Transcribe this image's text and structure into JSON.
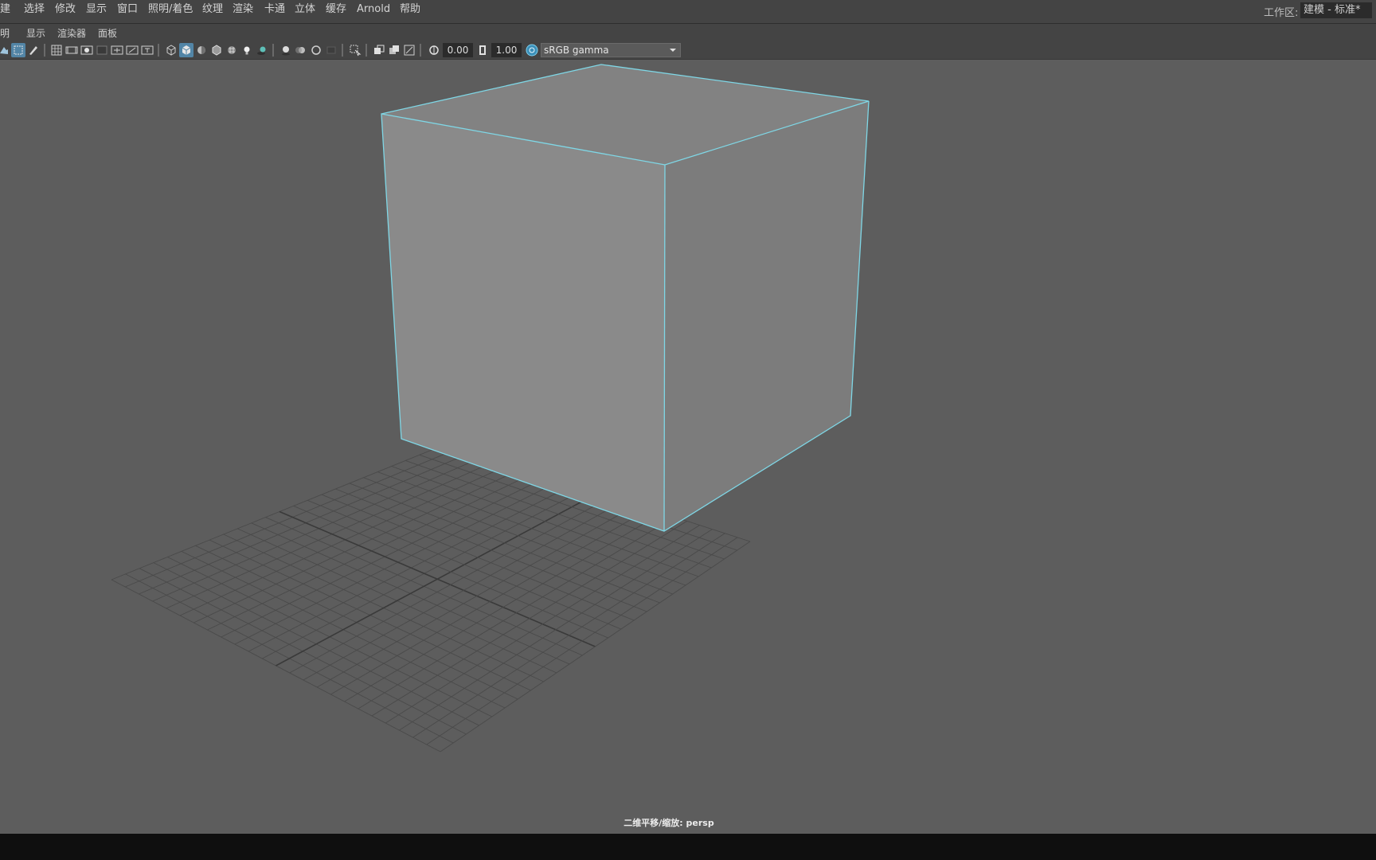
{
  "menubar": {
    "items": [
      "创建",
      "选择",
      "修改",
      "显示",
      "窗口",
      "照明/着色",
      "纹理",
      "渲染",
      "卡通",
      "立体",
      "缓存",
      "Arnold",
      "帮助"
    ],
    "workspace_label": "工作区:",
    "workspace_value": "建模 - 标准*"
  },
  "panel_menu": {
    "items": [
      "照明",
      "显示",
      "渲染器",
      "面板"
    ]
  },
  "toolbar": {
    "exposure_value": "0.00",
    "gamma_value": "1.00",
    "color_space": "sRGB gamma",
    "icons": [
      "camera-icon",
      "select-camera-icon",
      "paint-icon",
      "grid-icon",
      "film-gate-icon",
      "resolution-gate-icon",
      "gate-mask-icon",
      "field-chart-icon",
      "safe-action-icon",
      "safe-title-icon",
      "wireframe-icon",
      "smooth-shade-icon",
      "default-material-icon",
      "wireframe-on-shaded-icon",
      "textured-icon",
      "lights-icon",
      "shadows-icon",
      "screen-space-ao-icon",
      "motion-blur-icon",
      "antialiasing-icon",
      "depth-of-field-icon",
      "isolate-select-icon",
      "xray-icon",
      "xray-active-components-icon",
      "xray-joints-icon",
      "exposure-icon",
      "gamma-icon",
      "color-management-icon",
      "dropdown-arrow-icon"
    ]
  },
  "viewport": {
    "hud_text": "二维平移/缩放: persp",
    "wire_color": "#7fd7e6",
    "cube_front_color": "#8a8a8a",
    "cube_side_color": "#7c7c7c",
    "cube_top_color": "#828282",
    "grid_color": "#4a4a4a",
    "grid_axis_color": "#3a3a3a"
  }
}
